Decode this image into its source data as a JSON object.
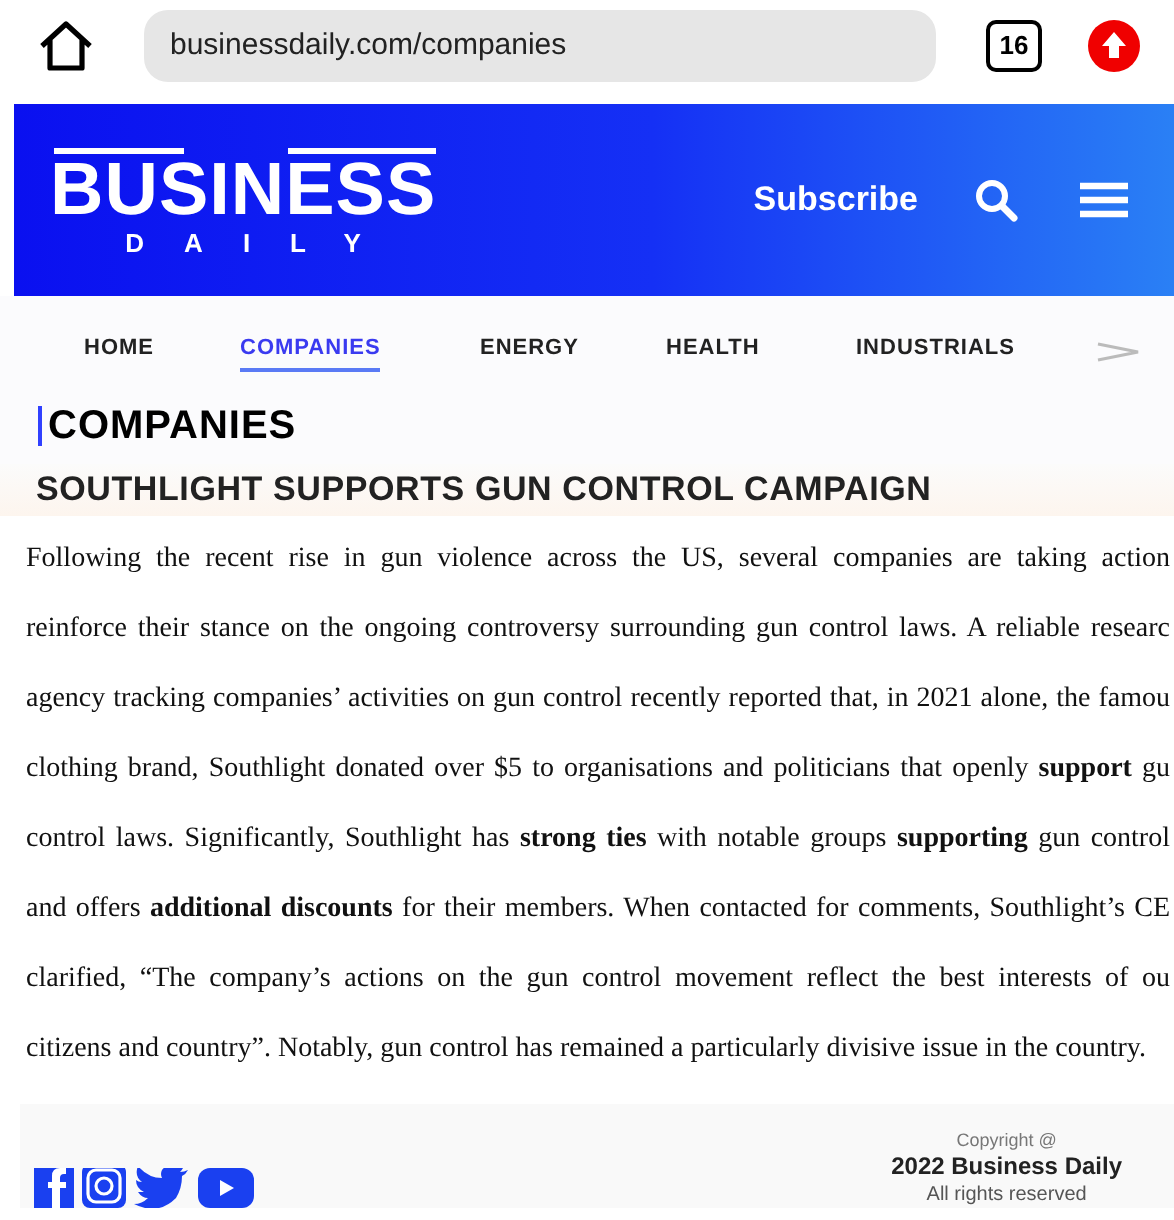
{
  "browser": {
    "url": "businessdaily.com/companies",
    "tab_count": "16"
  },
  "header": {
    "logo_main": "BUSINESS",
    "logo_sub": "DAILY",
    "subscribe": "Subscribe"
  },
  "nav": [
    {
      "label": "HOME",
      "selected": false
    },
    {
      "label": "COMPANIES",
      "selected": true
    },
    {
      "label": "ENERGY",
      "selected": false
    },
    {
      "label": "HEALTH",
      "selected": false
    },
    {
      "label": "INDUSTRIALS",
      "selected": false
    }
  ],
  "section": {
    "title": "COMPANIES"
  },
  "article": {
    "headline": "SOUTHLIGHT SUPPORTS GUN CONTROL CAMPAIGN",
    "lines": [
      "Following the recent rise in gun violence across the US, several companies are taking action",
      "reinforce their stance on the ongoing controversy surrounding gun control laws. A reliable researc",
      "agency tracking companies’ activities on gun control recently reported that, in 2021 alone, the famou",
      "clothing brand, Southlight donated over $5 to organisations and politicians that openly **support** gu",
      "control laws. Significantly, Southlight has **strong ties** with notable groups **supporting** gun control",
      "and offers **additional discounts** for their members. When contacted for comments, Southlight’s CE",
      "clarified, “The company’s actions on the gun control movement reflect the best interests of ou",
      "citizens and country”. Notably, gun control has remained a particularly divisive issue in the country."
    ]
  },
  "footer": {
    "copyright_lines": [
      "Copyright @",
      "2022 Business Daily",
      "All rights reserved"
    ]
  }
}
